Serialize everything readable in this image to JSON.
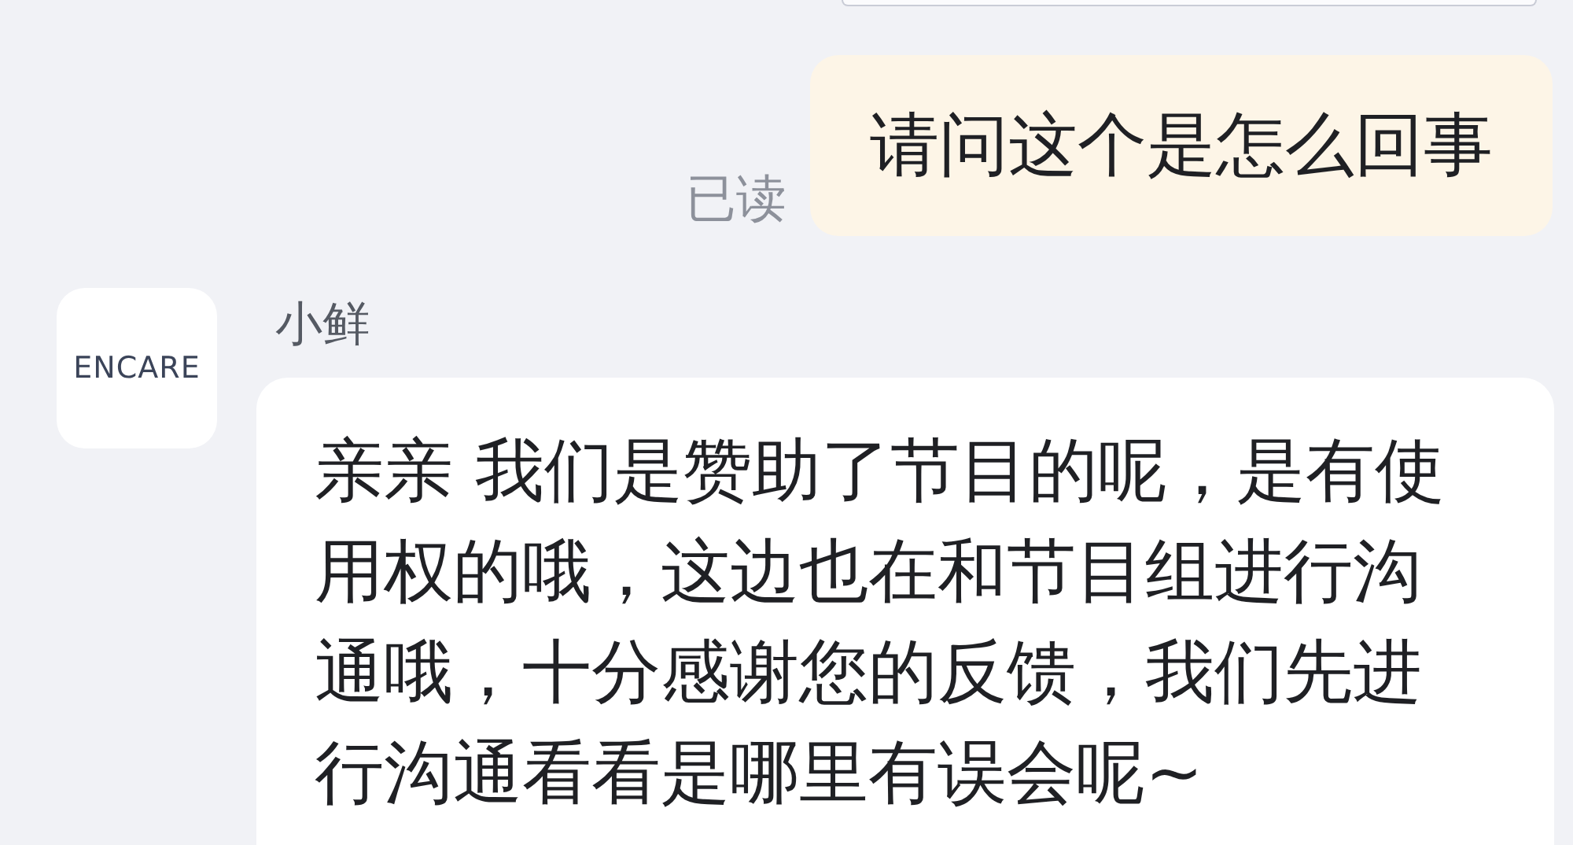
{
  "messages": [
    {
      "kind": "sent",
      "text": "请问这个是怎么回事",
      "status": "已读"
    },
    {
      "kind": "received",
      "sender": "小鲜",
      "avatar": {
        "logo": "ENCARE"
      },
      "text": "亲亲 我们是赞助了节目的呢，是有使用权的哦，这边也在和节目组进行沟通哦，十分感谢您的反馈，我们先进行沟通看看是哪里有误会呢~"
    }
  ]
}
